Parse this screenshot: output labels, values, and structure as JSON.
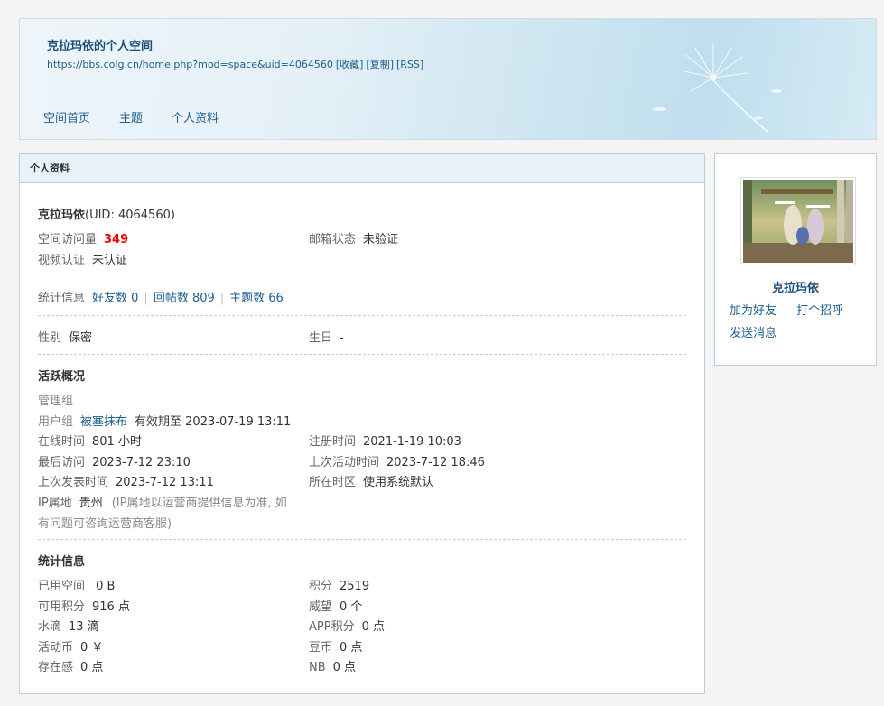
{
  "header": {
    "title": "克拉玛依的个人空间",
    "url": "https://bbs.colg.cn/home.php?mod=space&uid=4064560",
    "url_links": [
      "[收藏]",
      "[复制]",
      "[RSS]"
    ],
    "nav": [
      "空间首页",
      "主题",
      "个人资料"
    ]
  },
  "profile": {
    "panel_title": "个人资料",
    "name": "克拉玛依",
    "uid": "(UID: 4064560)",
    "visits_label": "空间访问量",
    "visits_value": "349",
    "email_label": "邮箱状态",
    "email_value": "未验证",
    "video_label": "视频认证",
    "video_value": "未认证",
    "stats_label": "统计信息",
    "friends": "好友数 0",
    "replies": "回帖数 809",
    "threads": "主题数 66",
    "gender_label": "性别",
    "gender_value": "保密",
    "birthday_label": "生日",
    "birthday_value": "-"
  },
  "activity": {
    "title": "活跃概况",
    "admin_group": "管理组",
    "user_group_label": "用户组",
    "user_group_value": "被塞抹布",
    "expiry": "有效期至 2023-07-19 13:11",
    "online_label": "在线时间",
    "online_value": "801 小时",
    "reg_label": "注册时间",
    "reg_value": "2021-1-19 10:03",
    "last_visit_label": "最后访问",
    "last_visit_value": "2023-7-12 23:10",
    "last_active_label": "上次活动时间",
    "last_active_value": "2023-7-12 18:46",
    "last_post_label": "上次发表时间",
    "last_post_value": "2023-7-12 13:11",
    "timezone_label": "所在时区",
    "timezone_value": "使用系统默认",
    "ip_label": "IP属地",
    "ip_value": "贵州",
    "ip_note1": "(IP属地以运营商提供信息为准, 如",
    "ip_note2": "有问题可咨询运营商客服)"
  },
  "statistics": {
    "title": "统计信息",
    "items": [
      {
        "label": "已用空间",
        "value": " 0 B"
      },
      {
        "label": "积分",
        "value": "2519"
      },
      {
        "label": "可用积分",
        "value": "916 点"
      },
      {
        "label": "威望",
        "value": "0 个"
      },
      {
        "label": "水滴",
        "value": "13 滴"
      },
      {
        "label": "APP积分",
        "value": "0 点"
      },
      {
        "label": "活动币",
        "value": "0 ￥"
      },
      {
        "label": "豆币",
        "value": "0 点"
      },
      {
        "label": "存在感",
        "value": "0 点"
      },
      {
        "label": "NB",
        "value": "0 点"
      }
    ]
  },
  "sidebar": {
    "name": "克拉玛依",
    "add_friend": "加为好友",
    "greet": "打个招呼",
    "send_message": "发送消息"
  },
  "colors": {
    "link": "#1b5e8c",
    "highlight": "#e00000",
    "panel_header_bg": "#e8f2fb"
  }
}
